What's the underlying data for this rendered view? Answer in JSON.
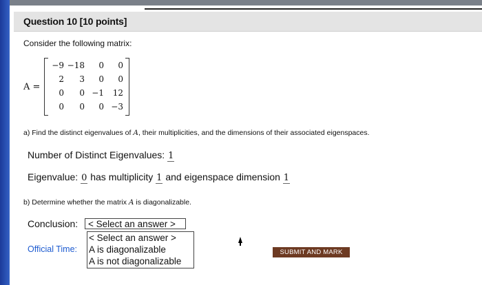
{
  "question": {
    "title": "Question 10 [10 points]",
    "prompt": "Consider the following matrix:",
    "matrix_label": "A =",
    "matrix": [
      [
        "−9",
        "−18",
        "0",
        "0"
      ],
      [
        "2",
        "3",
        "0",
        "0"
      ],
      [
        "0",
        "0",
        "−1",
        "12"
      ],
      [
        "0",
        "0",
        "0",
        "−3"
      ]
    ]
  },
  "part_a": {
    "text_before": "a) Find the distinct eigenvalues of ",
    "var": "A",
    "text_after": ", their multiplicities, and the dimensions of their associated eigenspaces.",
    "distinct_label": "Number of Distinct Eigenvalues:",
    "distinct_value": "1",
    "eigen_label": "Eigenvalue:",
    "eigen_value": "0",
    "has_mult_label": "has multiplicity",
    "mult_value": "1",
    "eigenspace_label": "and eigenspace dimension",
    "dim_value": "1"
  },
  "part_b": {
    "text_before": "b) Determine whether the matrix ",
    "var": "A",
    "text_after": " is diagonalizable."
  },
  "conclusion": {
    "label": "Conclusion:",
    "selected": "< Select an answer >",
    "options": [
      "< Select an answer >",
      "A is diagonalizable",
      "A is not diagonalizable"
    ]
  },
  "footer": {
    "official_time": "Official Time:",
    "submit_label": "SUBMIT AND MARK"
  }
}
